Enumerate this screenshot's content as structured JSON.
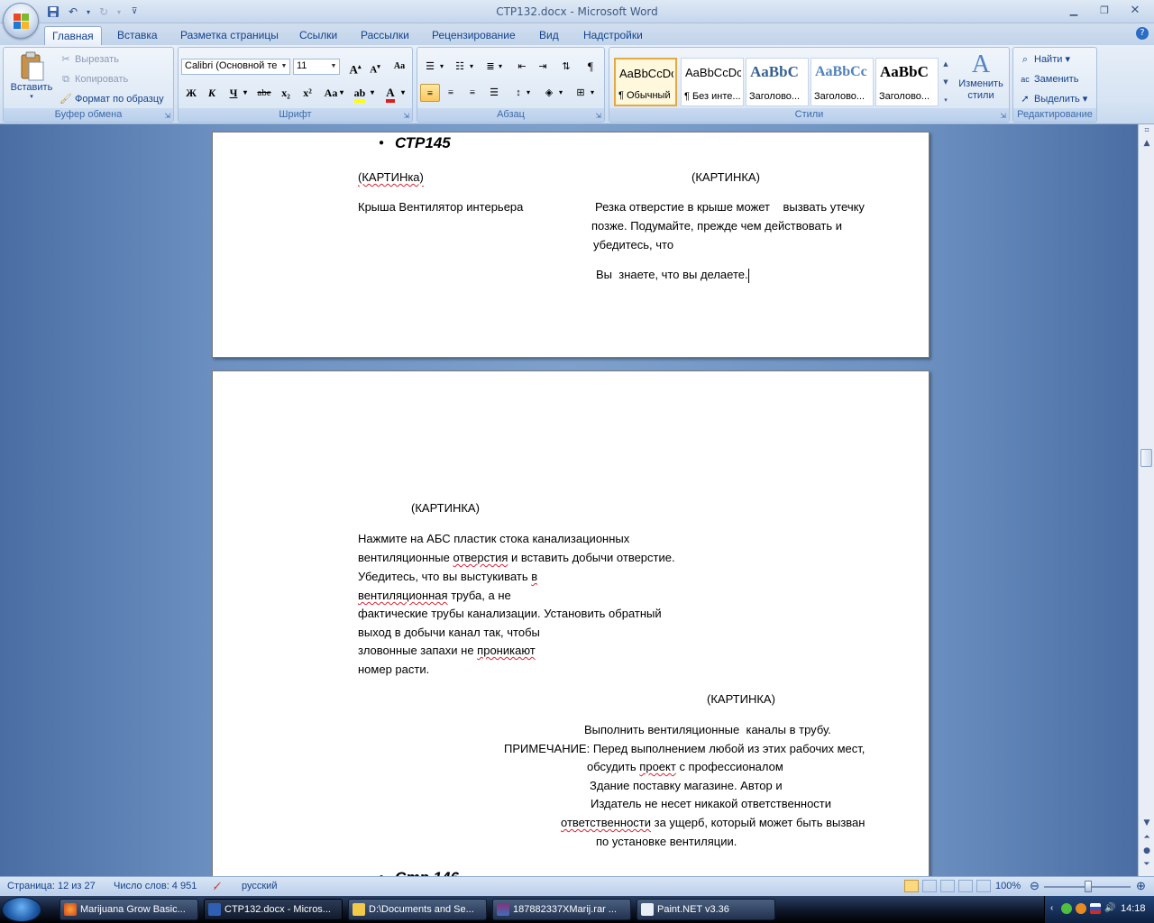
{
  "window": {
    "title": "CTP132.docx - Microsoft Word"
  },
  "tabs": [
    "Главная",
    "Вставка",
    "Разметка страницы",
    "Ссылки",
    "Рассылки",
    "Рецензирование",
    "Вид",
    "Надстройки"
  ],
  "clipboard": {
    "paste": "Вставить",
    "cut": "Вырезать",
    "copy": "Копировать",
    "format_painter": "Формат по образцу",
    "label": "Буфер обмена"
  },
  "font": {
    "name": "Calibri (Основной те",
    "size": "11",
    "label": "Шрифт",
    "bold": "Ж",
    "italic": "К",
    "underline": "Ч",
    "strike": "abe",
    "sub": "x₂",
    "sup": "x²",
    "case": "Aa"
  },
  "paragraph": {
    "label": "Абзац"
  },
  "styles": {
    "label": "Стили",
    "items": [
      {
        "preview": "AaBbCcDc",
        "name": "¶ Обычный"
      },
      {
        "preview": "AaBbCcDc",
        "name": "¶ Без инте..."
      },
      {
        "preview": "AaBbC",
        "name": "Заголово..."
      },
      {
        "preview": "AaBbCc",
        "name": "Заголово..."
      },
      {
        "preview": "AaBbC",
        "name": "Заголово..."
      }
    ],
    "change": "Изменить стили"
  },
  "editing": {
    "find": "Найти",
    "replace": "Заменить",
    "select": "Выделить",
    "label": "Редактирование"
  },
  "doc": {
    "p1": {
      "bullet": "СТР145",
      "pic_left": "(КАРТИНка)",
      "pic_right": "(КАРТИНКА)",
      "left_text": "Крыша Вентилятор интерьера",
      "right_lines": [
        "Резка отверстие в крыше может    вызвать утечку",
        "позже. Подумайте, прежде чем действовать и",
        "убедитесь, что"
      ],
      "right_last": "Вы  знаете, что вы делаете."
    },
    "p2": {
      "pic1": "(КАРТИНКА)",
      "para": [
        "Нажмите на АБС пластик стока канализационных",
        "вентиляционные отверстия и вставить добычи отверстие.",
        "Убедитесь, что вы выстукивать в",
        "вентиляционная труба, а не",
        "фактические трубы канализации. Установить обратный",
        "выход в добычи канал так, чтобы",
        "зловонные запахи не проникают",
        "номер расти."
      ],
      "pic2": "(КАРТИНКА)",
      "note": [
        "Выполнить вентиляционные  каналы в трубу.",
        "ПРИМЕЧАНИЕ: Перед выполнением любой из этих рабочих мест,",
        "обсудить проект с профессионалом",
        "Здание поставку магазине. Автор и",
        "Издатель не несет никакой ответственности",
        "ответственности за ущерб, который может быть вызван",
        "по установке вентиляции."
      ],
      "next_bullet": "Стр 146"
    }
  },
  "status": {
    "page": "Страница: 12 из 27",
    "words": "Число слов: 4 951",
    "lang": "русский",
    "zoom": "100%"
  },
  "taskbar": {
    "items": [
      "Marijuana Grow Basic...",
      "CTP132.docx - Micros...",
      "D:\\Documents and Se...",
      "187882337XMarij.rar ...",
      "Paint.NET v3.36"
    ],
    "clock": "14:18"
  }
}
